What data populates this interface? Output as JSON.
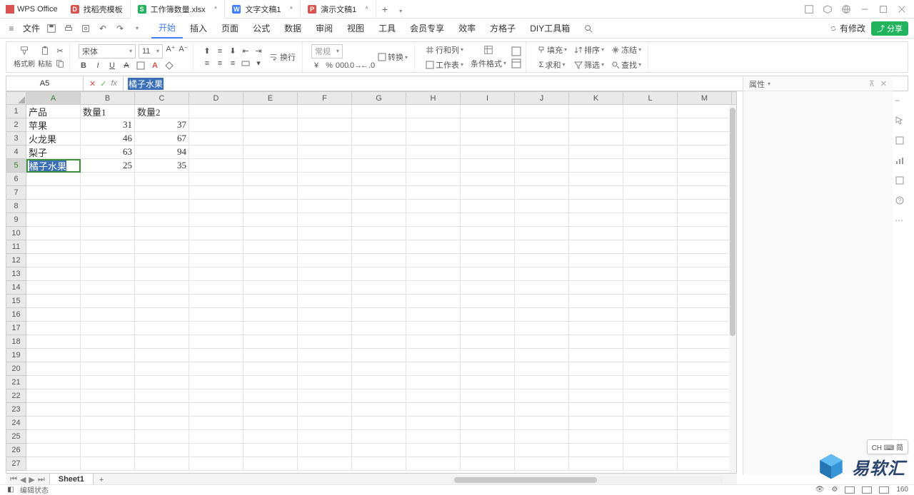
{
  "app": {
    "name": "WPS Office"
  },
  "tabs": [
    {
      "label": "找稻壳模板",
      "icon_color": "#d9534f",
      "icon_letter": "D"
    },
    {
      "label": "工作簿数量.xlsx",
      "icon_color": "#22b35e",
      "icon_letter": "S",
      "active": true,
      "dirty": "*"
    },
    {
      "label": "文字文稿1",
      "icon_color": "#417ff9",
      "icon_letter": "W",
      "dirty": "*"
    },
    {
      "label": "演示文稿1",
      "icon_color": "#d9534f",
      "icon_letter": "P",
      "dirty": "*"
    }
  ],
  "menubar": {
    "file": "文件",
    "items": [
      "开始",
      "插入",
      "页面",
      "公式",
      "数据",
      "审阅",
      "视图",
      "工具",
      "会员专享",
      "效率",
      "方格子",
      "DIY工具箱"
    ],
    "active": "开始",
    "revise": "有修改",
    "share": "分享"
  },
  "ribbon": {
    "paste": "格式刷",
    "pastebtn": "粘贴",
    "font_name": "宋体",
    "font_size": "11",
    "wrap": "换行",
    "number_format": "常规",
    "convert": "转换",
    "rowcol": "行和列",
    "worksheet": "工作表",
    "cond_fmt": "条件格式",
    "fill": "填充",
    "sort": "排序",
    "freeze": "冻结",
    "sum": "求和",
    "filter": "筛选",
    "find": "查找"
  },
  "formula": {
    "name_box": "A5",
    "editing_text": "橘子水果"
  },
  "columns": [
    "A",
    "B",
    "C",
    "D",
    "E",
    "F",
    "G",
    "H",
    "I",
    "J",
    "K",
    "L",
    "M"
  ],
  "selected_col": "A",
  "selected_row": 5,
  "sheet_data": {
    "headers": [
      "产品",
      "数量1",
      "数量2"
    ],
    "rows": [
      [
        "苹果",
        31,
        37
      ],
      [
        "火龙果",
        46,
        67
      ],
      [
        "梨子",
        63,
        94
      ],
      [
        "橘子水果",
        25,
        35
      ]
    ]
  },
  "row_count": 27,
  "right_panel": {
    "title": "属性"
  },
  "sheet_tabs": {
    "active": "Sheet1"
  },
  "status": {
    "mode": "编辑状态",
    "zoom": "160"
  },
  "ime": "CH ⌨ 简",
  "watermark": "易软汇"
}
